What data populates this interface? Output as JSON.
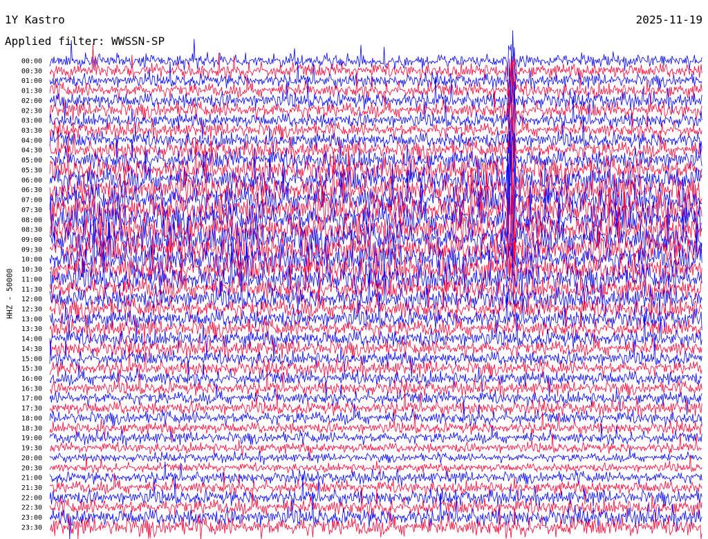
{
  "header": {
    "station": "1Y Kastro",
    "date": "2025-11-19",
    "filter": "Applied filter: WWSSN-SP"
  },
  "axis": {
    "channel": "HHZ - 50000"
  },
  "chart_data": {
    "type": "line",
    "title": "1Y Kastro",
    "subtitle": "Applied filter: WWSSN-SP",
    "ylabel": "HHZ - 50000",
    "y_tick_labels": [
      "00:00",
      "00:30",
      "01:00",
      "01:30",
      "02:00",
      "02:30",
      "03:00",
      "03:30",
      "04:00",
      "04:30",
      "05:00",
      "05:30",
      "06:00",
      "06:30",
      "07:00",
      "07:30",
      "08:00",
      "08:30",
      "09:00",
      "09:30",
      "10:00",
      "10:30",
      "11:00",
      "11:30",
      "12:00",
      "12:30",
      "13:00",
      "13:30",
      "14:00",
      "14:30",
      "15:00",
      "15:30",
      "16:00",
      "16:30",
      "17:00",
      "17:30",
      "18:00",
      "18:30",
      "19:00",
      "19:30",
      "20:00",
      "20:30",
      "21:00",
      "21:30",
      "22:00",
      "22:30",
      "23:00",
      "23:30"
    ],
    "trace_colors": [
      "#0000ff",
      "#ff0033"
    ],
    "trace_amplitude": [
      0.9,
      1.0,
      0.9,
      1.0,
      1.1,
      1.1,
      1.0,
      1.0,
      1.1,
      1.2,
      1.4,
      1.6,
      1.8,
      1.9,
      2.0,
      2.1,
      2.1,
      2.1,
      2.1,
      2.0,
      2.0,
      1.9,
      1.8,
      1.6,
      1.5,
      1.4,
      1.3,
      1.2,
      1.2,
      1.1,
      1.0,
      1.0,
      1.0,
      0.9,
      0.9,
      0.9,
      0.9,
      0.8,
      0.8,
      0.7,
      0.6,
      0.6,
      0.8,
      0.9,
      1.0,
      1.1,
      1.2,
      1.3
    ],
    "event_time_fraction": 0.707,
    "grid": false,
    "legend": "none"
  }
}
